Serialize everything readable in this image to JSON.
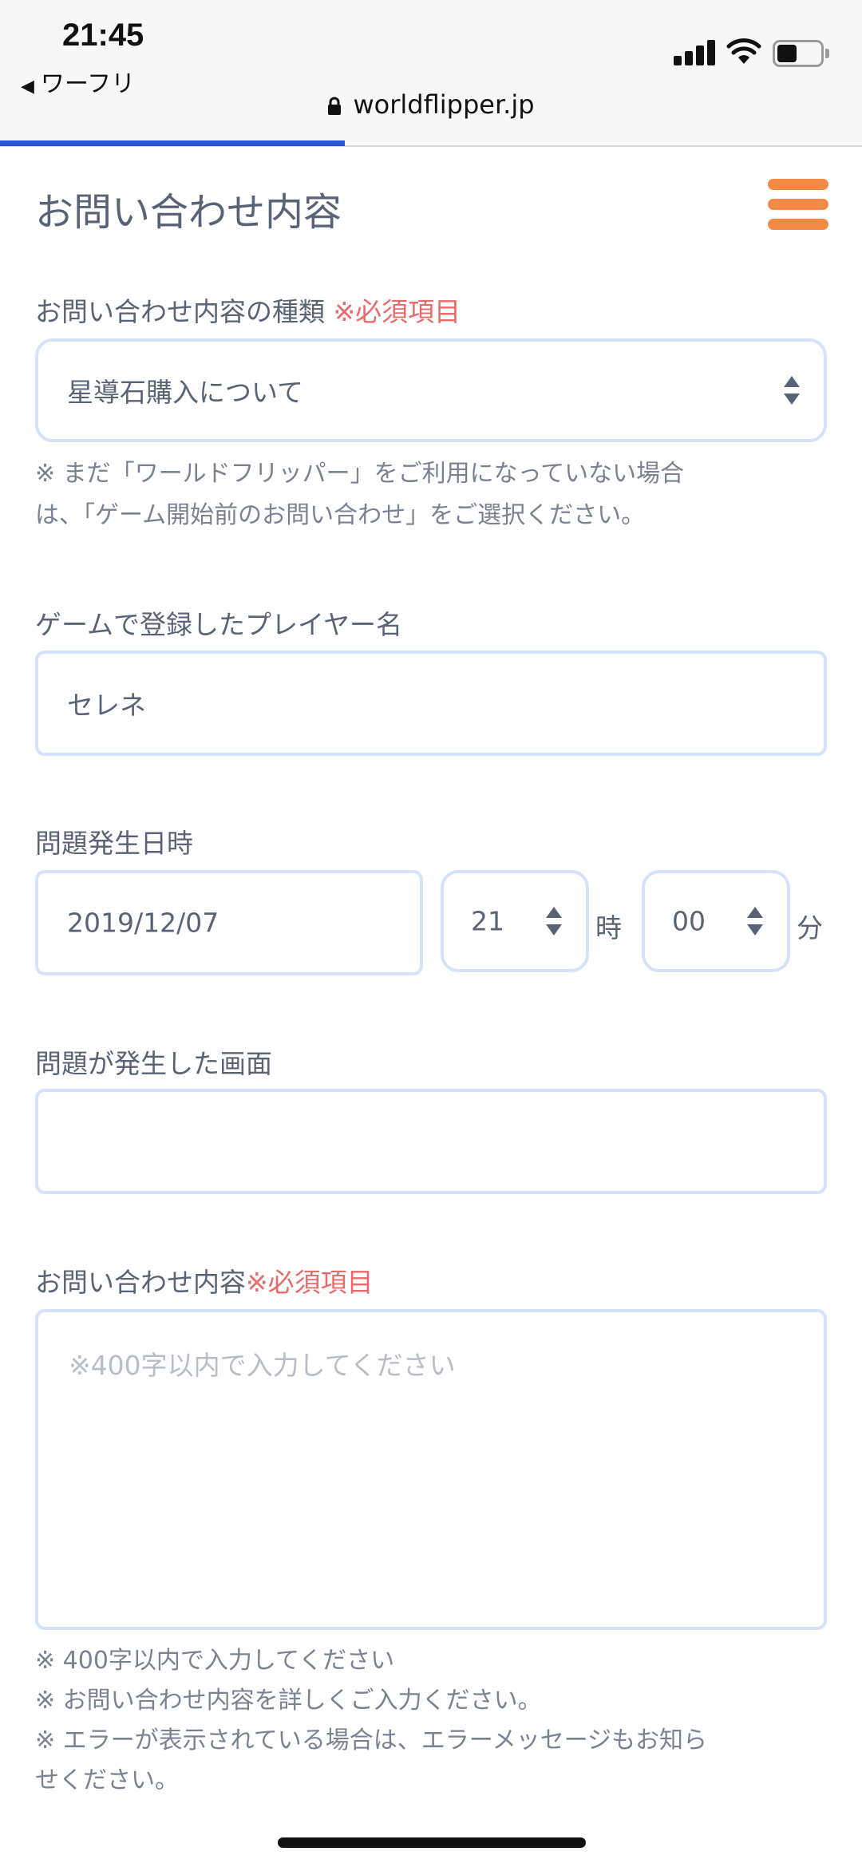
{
  "status_bar": {
    "time": "21:45",
    "back_app": "ワーフリ",
    "back_icon": "back-triangle-icon",
    "url": "worldflipper.jp",
    "progress": 0.4
  },
  "header": {
    "title": "お問い合わせ内容",
    "menu_icon": "hamburger-menu-icon",
    "menu_color": "#f28a45"
  },
  "form": {
    "inquiry_type": {
      "label": "お問い合わせ内容の種類",
      "required": "※必須項目",
      "value": "星導石購入について",
      "note_line1": "※ まだ「ワールドフリッパー」をご利用になっていない場合",
      "note_line2": "は、「ゲーム開始前のお問い合わせ」をご選択ください。"
    },
    "player_name": {
      "label": "ゲームで登録したプレイヤー名",
      "value": "セレネ"
    },
    "occurred_at": {
      "label": "問題発生日時",
      "date": "2019/12/07",
      "hour": "21",
      "hour_unit": "時",
      "minute": "00",
      "minute_unit": "分"
    },
    "screen": {
      "label": "問題が発生した画面",
      "value": ""
    },
    "content": {
      "label": "お問い合わせ内容",
      "required": "※必須項目",
      "placeholder": "※400字以内で入力してください",
      "note_line1": "※ 400字以内で入力してください",
      "note_line2": "※ お問い合わせ内容を詳しくご入力ください。",
      "note_line3": "※ エラーが表示されている場合は、エラーメッセージもお知ら",
      "note_line4": "せください。"
    }
  },
  "colors": {
    "accent_progress": "#2a55d4",
    "required": "#e96a6a",
    "field_border": "#d6e2fb",
    "text": "#5a6275"
  }
}
